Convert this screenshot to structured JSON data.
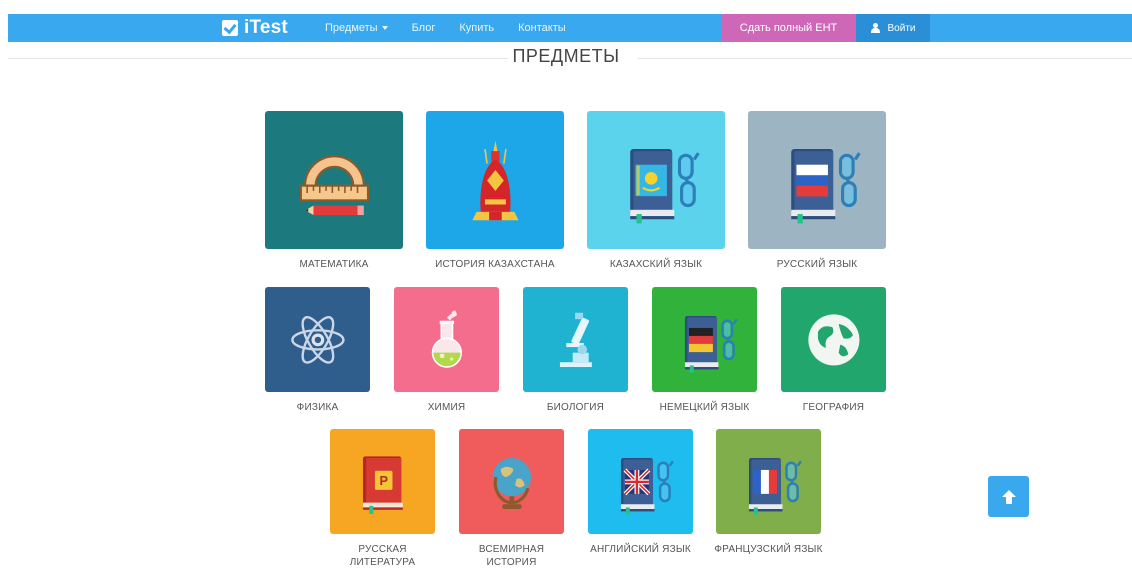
{
  "navbar": {
    "brand": "iTest",
    "links": [
      {
        "label": "Предметы",
        "dropdown": true
      },
      {
        "label": "Блог"
      },
      {
        "label": "Купить"
      },
      {
        "label": "Контакты"
      }
    ],
    "cta_label": "Сдать полный ЕНТ",
    "login_label": "Войти"
  },
  "section": {
    "title": "ПРЕДМЕТЫ"
  },
  "subjects": [
    {
      "label": "МАТЕМАТИКА",
      "color": "#1c7a7f",
      "icon": "ruler-protractor-icon"
    },
    {
      "label": "ИСТОРИЯ КАЗАХСТАНА",
      "color": "#1ea7e8",
      "icon": "golden-helmet-icon"
    },
    {
      "label": "КАЗАХСКИЙ ЯЗЫК",
      "color": "#5bd3ec",
      "icon": "kazakh-flag-book-icon"
    },
    {
      "label": "РУССКИЙ ЯЗЫК",
      "color": "#9db5c2",
      "icon": "russian-flag-book-icon"
    },
    {
      "label": "ФИЗИКА",
      "color": "#2f5d8c",
      "icon": "atom-icon"
    },
    {
      "label": "ХИМИЯ",
      "color": "#f46d8d",
      "icon": "flask-icon"
    },
    {
      "label": "БИОЛОГИЯ",
      "color": "#1fb3d1",
      "icon": "microscope-icon"
    },
    {
      "label": "НЕМЕЦКИЙ ЯЗЫК",
      "color": "#31b23b",
      "icon": "german-flag-book-icon"
    },
    {
      "label": "ГЕОГРАФИЯ",
      "color": "#21a66d",
      "icon": "globe-map-icon"
    },
    {
      "label": "РУССКАЯ ЛИТЕРАТУРА",
      "color": "#f7a623",
      "icon": "literature-book-icon"
    },
    {
      "label": "ВСЕМИРНАЯ ИСТОРИЯ",
      "color": "#f05b5b",
      "icon": "desk-globe-icon"
    },
    {
      "label": "АНГЛИЙСКИЙ ЯЗЫК",
      "color": "#1fbdef",
      "icon": "uk-flag-book-icon"
    },
    {
      "label": "ФРАНЦУЗСКИЙ ЯЗЫК",
      "color": "#7fae4b",
      "icon": "french-flag-book-icon"
    }
  ],
  "scroll_top": {
    "icon": "arrow-up-icon"
  }
}
